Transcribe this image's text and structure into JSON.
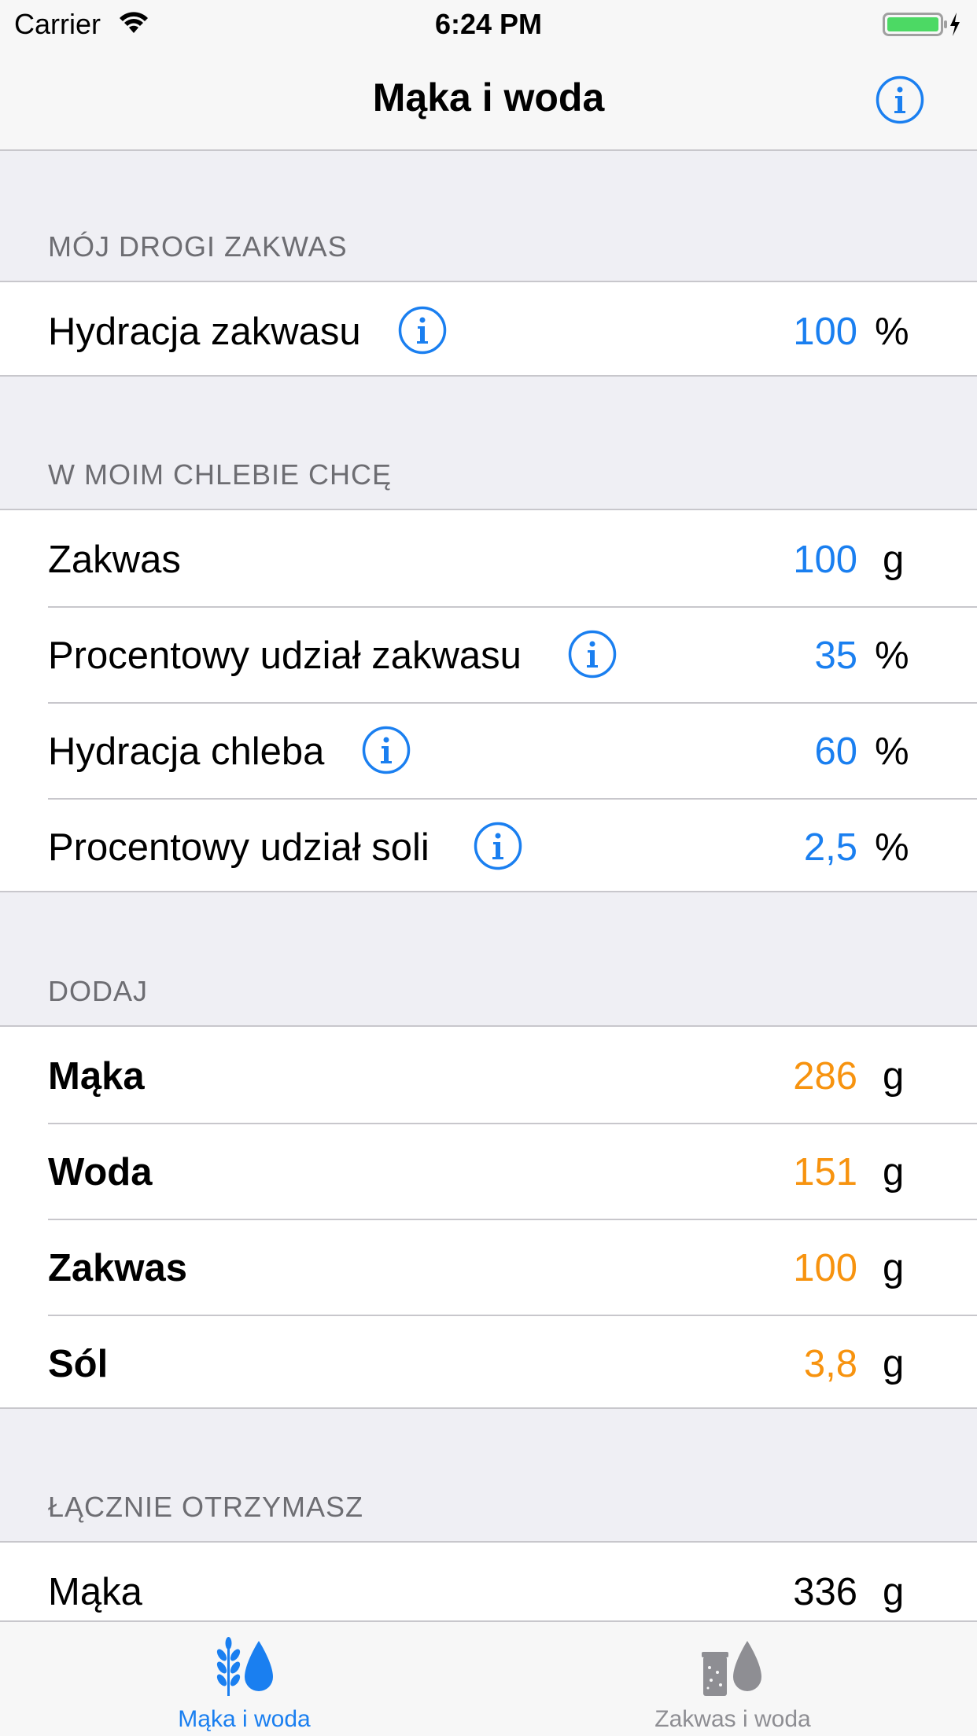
{
  "status_bar": {
    "carrier": "Carrier",
    "time": "6:24 PM",
    "battery_color": "#4cd964"
  },
  "nav": {
    "title": "Mąka i woda",
    "info_icon": "info-circle-icon"
  },
  "sections": {
    "starter": {
      "header": "MÓJ DROGI ZAKWAS",
      "rows": [
        {
          "label": "Hydracja zakwasu",
          "value": "100",
          "unit": "%"
        }
      ]
    },
    "bread": {
      "header": "W MOIM CHLEBIE CHCĘ",
      "rows": [
        {
          "label": "Zakwas",
          "value": "100",
          "unit": "g"
        },
        {
          "label": "Procentowy udział zakwasu",
          "value": "35",
          "unit": "%"
        },
        {
          "label": "Hydracja chleba",
          "value": "60",
          "unit": "%"
        },
        {
          "label": "Procentowy udział soli",
          "value": "2,5",
          "unit": "%"
        }
      ]
    },
    "add": {
      "header": "DODAJ",
      "rows": [
        {
          "label": "Mąka",
          "value": "286",
          "unit": "g"
        },
        {
          "label": "Woda",
          "value": "151",
          "unit": "g"
        },
        {
          "label": "Zakwas",
          "value": "100",
          "unit": "g"
        },
        {
          "label": "Sól",
          "value": "3,8",
          "unit": "g"
        }
      ]
    },
    "total": {
      "header": "ŁĄCZNIE OTRZYMASZ",
      "rows": [
        {
          "label": "Mąka",
          "value": "336",
          "unit": "g"
        }
      ]
    }
  },
  "tabs": [
    {
      "label": "Mąka i woda",
      "icon": "wheat-water-icon",
      "active": true
    },
    {
      "label": "Zakwas i woda",
      "icon": "jar-water-icon",
      "active": false
    }
  ],
  "colors": {
    "accent": "#1a7ff0",
    "result": "#f7930f",
    "inactive": "#8e8e93"
  }
}
